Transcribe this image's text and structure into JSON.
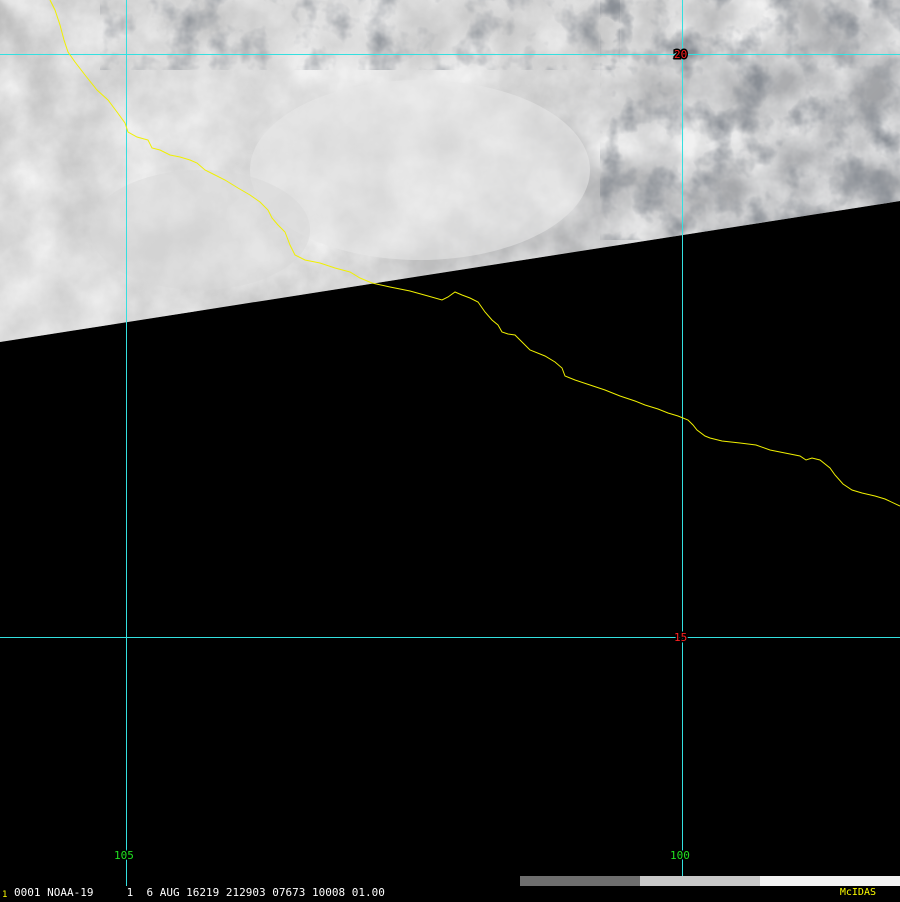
{
  "map": {
    "latitude_labels": [
      "20",
      "15"
    ],
    "longitude_labels": [
      "105",
      "100"
    ],
    "colors": {
      "grid": "#33e0e0",
      "latitude_label": "#ff2020",
      "longitude_label": "#20e020",
      "coastline": "#f0f000",
      "background": "#000000"
    }
  },
  "status_bar": {
    "prefix": "1",
    "text": "0001 NOAA-19     1  6 AUG 16219 212903 07673 10008 01.00",
    "brand": "McIDAS",
    "colors": {
      "text": "#ffffff",
      "prefix": "#ffff00",
      "brand": "#ffff00"
    }
  }
}
